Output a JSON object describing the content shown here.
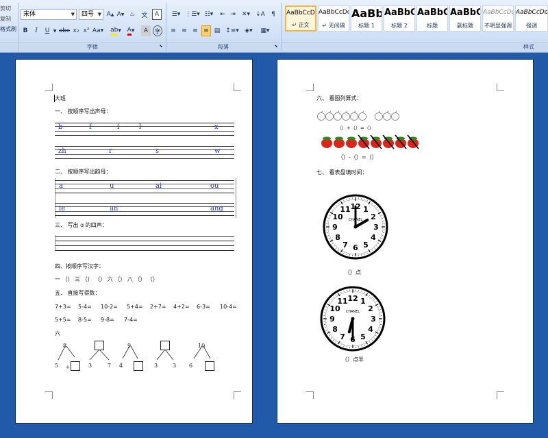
{
  "ribbon": {
    "left_partial": [
      "剪切",
      "复制",
      "格式刷"
    ],
    "font_name": "宋体",
    "font_size": "四号",
    "group_labels": {
      "font": "字体",
      "paragraph": "段落",
      "styles": "样式"
    },
    "styles": [
      {
        "sample": "AaBbCcDd",
        "name": "正文"
      },
      {
        "sample": "AaBbCcDd",
        "name": "无间隔"
      },
      {
        "sample": "AaBb",
        "name": "标题 1"
      },
      {
        "sample": "AaBbC",
        "name": "标题 2"
      },
      {
        "sample": "AaBbC",
        "name": "标题"
      },
      {
        "sample": "AaBbC",
        "name": "副标题"
      },
      {
        "sample": "AaBbCcDd",
        "name": "不明显强调"
      },
      {
        "sample": "AaBbCcDd",
        "name": "强调"
      }
    ]
  },
  "page1": {
    "title": "大班",
    "s1": "一、   按顺序写出声母：",
    "s1_row1": [
      "b",
      "f",
      "i",
      "l",
      "x"
    ],
    "s1_row2": [
      "zh",
      "r",
      "s",
      "w"
    ],
    "s2": "二、   按顺序写出韵母：",
    "s2_row1": [
      "a",
      "u",
      "ai",
      "ou"
    ],
    "s2_row2": [
      "ie",
      "an",
      "ang"
    ],
    "s3": "三、   写出 ɑ 的四声：",
    "s4": "四、按顺序写汉字：",
    "s4_line": "一  （）  三  （）  （）  六  （）  八  （）  （）",
    "s5": "五、   直接写得数：",
    "s5_row1": [
      "7+3=",
      "5-4=",
      "10-2=",
      "5+4=",
      "2+7=",
      "4+2=",
      "6-3=",
      "10-4="
    ],
    "s5_row2": [
      "5+5=",
      "8-5=",
      "9-8=",
      "7-4="
    ],
    "s6": "六",
    "tree_tops": [
      "8",
      "9",
      "10"
    ],
    "tree_bottoms": [
      "5",
      "+",
      "3",
      "7",
      "4",
      "3",
      "3",
      "6"
    ]
  },
  "page2": {
    "s6": "六、   看图列算式：",
    "eq1": "（）+（）=（）",
    "eq2": "（）-（）=（）",
    "s7": "七、   看表盘填时间：",
    "clock_brand": "CHANEL",
    "clock1_caption": "（）点",
    "clock2_caption": "（）点半",
    "clock_numbers": [
      "12",
      "1",
      "2",
      "3",
      "4",
      "5",
      "6",
      "7",
      "8",
      "9",
      "10",
      "11"
    ]
  }
}
